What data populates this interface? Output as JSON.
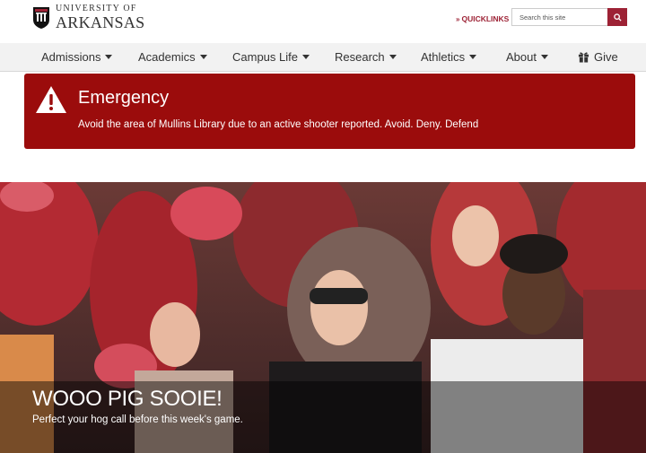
{
  "header": {
    "logo_top": "UNIVERSITY OF",
    "logo_bottom": "ARKANSAS",
    "quicklinks_label": "QUICKLINKS",
    "search_placeholder": "Search this site"
  },
  "nav": {
    "items": [
      {
        "label": "Admissions"
      },
      {
        "label": "Academics"
      },
      {
        "label": "Campus Life"
      },
      {
        "label": "Research"
      },
      {
        "label": "Athletics"
      },
      {
        "label": "About"
      },
      {
        "label": "Give"
      }
    ]
  },
  "emergency": {
    "title": "Emergency",
    "message": "Avoid the area of Mullins Library due to an active shooter reported. Avoid. Deny. Defend"
  },
  "hero": {
    "title": "WOOO PIG SOOIE!",
    "subtitle": "Perfect your hog call before this week's game."
  },
  "colors": {
    "brand": "#9d2235",
    "emergency_bg": "#9b0c0c",
    "nav_bg": "#f2f2f2"
  }
}
